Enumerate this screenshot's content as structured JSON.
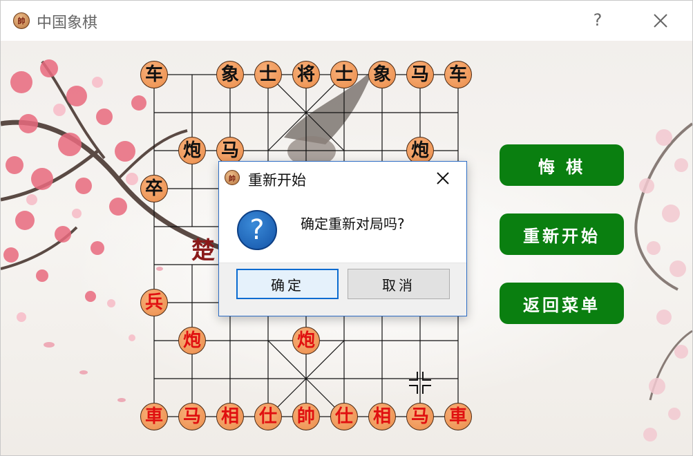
{
  "window": {
    "title": "中国象棋",
    "icon_glyph": "帥",
    "help_label": "?"
  },
  "board": {
    "river_left": "楚",
    "black_pieces": [
      {
        "glyph": "车",
        "col": 0,
        "row": 0
      },
      {
        "glyph": "象",
        "col": 2,
        "row": 0
      },
      {
        "glyph": "士",
        "col": 3,
        "row": 0
      },
      {
        "glyph": "将",
        "col": 4,
        "row": 0
      },
      {
        "glyph": "士",
        "col": 5,
        "row": 0
      },
      {
        "glyph": "象",
        "col": 6,
        "row": 0
      },
      {
        "glyph": "马",
        "col": 7,
        "row": 0
      },
      {
        "glyph": "车",
        "col": 8,
        "row": 0
      },
      {
        "glyph": "炮",
        "col": 1,
        "row": 2
      },
      {
        "glyph": "马",
        "col": 2,
        "row": 2
      },
      {
        "glyph": "炮",
        "col": 7,
        "row": 2
      },
      {
        "glyph": "卒",
        "col": 0,
        "row": 3
      }
    ],
    "red_pieces": [
      {
        "glyph": "兵",
        "col": 0,
        "row": 6
      },
      {
        "glyph": "炮",
        "col": 1,
        "row": 7
      },
      {
        "glyph": "炮",
        "col": 4,
        "row": 7
      },
      {
        "glyph": "車",
        "col": 0,
        "row": 9
      },
      {
        "glyph": "马",
        "col": 1,
        "row": 9
      },
      {
        "glyph": "相",
        "col": 2,
        "row": 9
      },
      {
        "glyph": "仕",
        "col": 3,
        "row": 9
      },
      {
        "glyph": "帥",
        "col": 4,
        "row": 9
      },
      {
        "glyph": "仕",
        "col": 5,
        "row": 9
      },
      {
        "glyph": "相",
        "col": 6,
        "row": 9
      },
      {
        "glyph": "马",
        "col": 7,
        "row": 9
      },
      {
        "glyph": "車",
        "col": 8,
        "row": 9
      }
    ]
  },
  "side_buttons": {
    "undo": "悔  棋",
    "restart": "重新开始",
    "menu": "返回菜单"
  },
  "dialog": {
    "title": "重新开始",
    "icon_glyph": "帥",
    "message": "确定重新对局吗?",
    "ok_label": "确定",
    "cancel_label": "取消"
  },
  "colors": {
    "button_green": "#0a7f10",
    "piece_fill": "#ef9859",
    "red_text": "#e01010",
    "dialog_border": "#2c6cc4"
  }
}
